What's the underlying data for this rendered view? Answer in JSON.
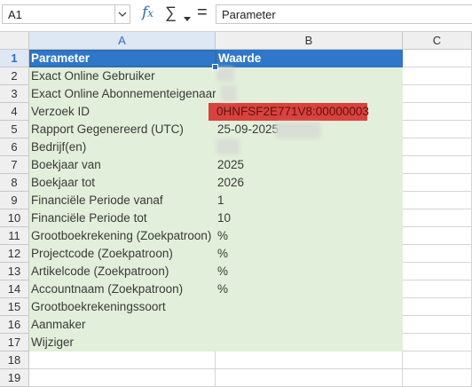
{
  "formula_bar": {
    "name_box": "A1",
    "content": "Parameter"
  },
  "columns": [
    "A",
    "B",
    "C"
  ],
  "rows": [
    {
      "num": "1",
      "a": "Parameter",
      "b": "Waarde"
    },
    {
      "num": "2",
      "a": "Exact Online Gebruiker",
      "b": ""
    },
    {
      "num": "3",
      "a": "Exact Online Abonnementeigenaar",
      "b": ""
    },
    {
      "num": "4",
      "a": "Verzoek ID",
      "b": "0HNFSF2E771V8:00000003"
    },
    {
      "num": "5",
      "a": "Rapport Gegenereerd (UTC)",
      "b": "25-09-2025"
    },
    {
      "num": "6",
      "a": "Bedrijf(en)",
      "b": ""
    },
    {
      "num": "7",
      "a": "Boekjaar van",
      "b": "2025"
    },
    {
      "num": "8",
      "a": "Boekjaar tot",
      "b": "2026"
    },
    {
      "num": "9",
      "a": "Financiële Periode vanaf",
      "b": "1"
    },
    {
      "num": "10",
      "a": "Financiële Periode tot",
      "b": "10"
    },
    {
      "num": "11",
      "a": "Grootboekrekening (Zoekpatroon)",
      "b": "%"
    },
    {
      "num": "12",
      "a": "Projectcode (Zoekpatroon)",
      "b": "%"
    },
    {
      "num": "13",
      "a": "Artikelcode (Zoekpatroon)",
      "b": "%"
    },
    {
      "num": "14",
      "a": "Accountnaam (Zoekpatroon)",
      "b": "%"
    },
    {
      "num": "15",
      "a": "Grootboekrekeningssoort",
      "b": ""
    },
    {
      "num": "16",
      "a": "Aanmaker",
      "b": ""
    },
    {
      "num": "17",
      "a": "Wijziger",
      "b": ""
    },
    {
      "num": "18",
      "a": "",
      "b": ""
    },
    {
      "num": "19",
      "a": "",
      "b": ""
    }
  ],
  "icons": {
    "function_wizard": "fx-icon",
    "sum": "sum-icon",
    "formula": "equals-icon"
  },
  "colors": {
    "header_fill": "#2f77c8",
    "data_fill": "#e2efda",
    "highlight_fill": "#d9423e",
    "selection": "#2f6eb5"
  }
}
